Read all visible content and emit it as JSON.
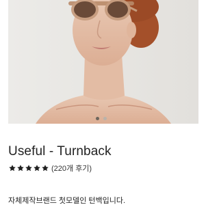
{
  "product": {
    "title": "Useful - Turnback",
    "rating": 5,
    "review_count_text": "(220개 후기)",
    "description": "자체제작브랜드 첫모델인 턴백입니다."
  },
  "carousel": {
    "slide_count": 2,
    "active_index": 0
  },
  "colors": {
    "star": "#1f1f1f",
    "photo_background": "#e7e6e2",
    "frame_tint": "#c59b7d"
  },
  "icons": {
    "star": "star-icon"
  }
}
